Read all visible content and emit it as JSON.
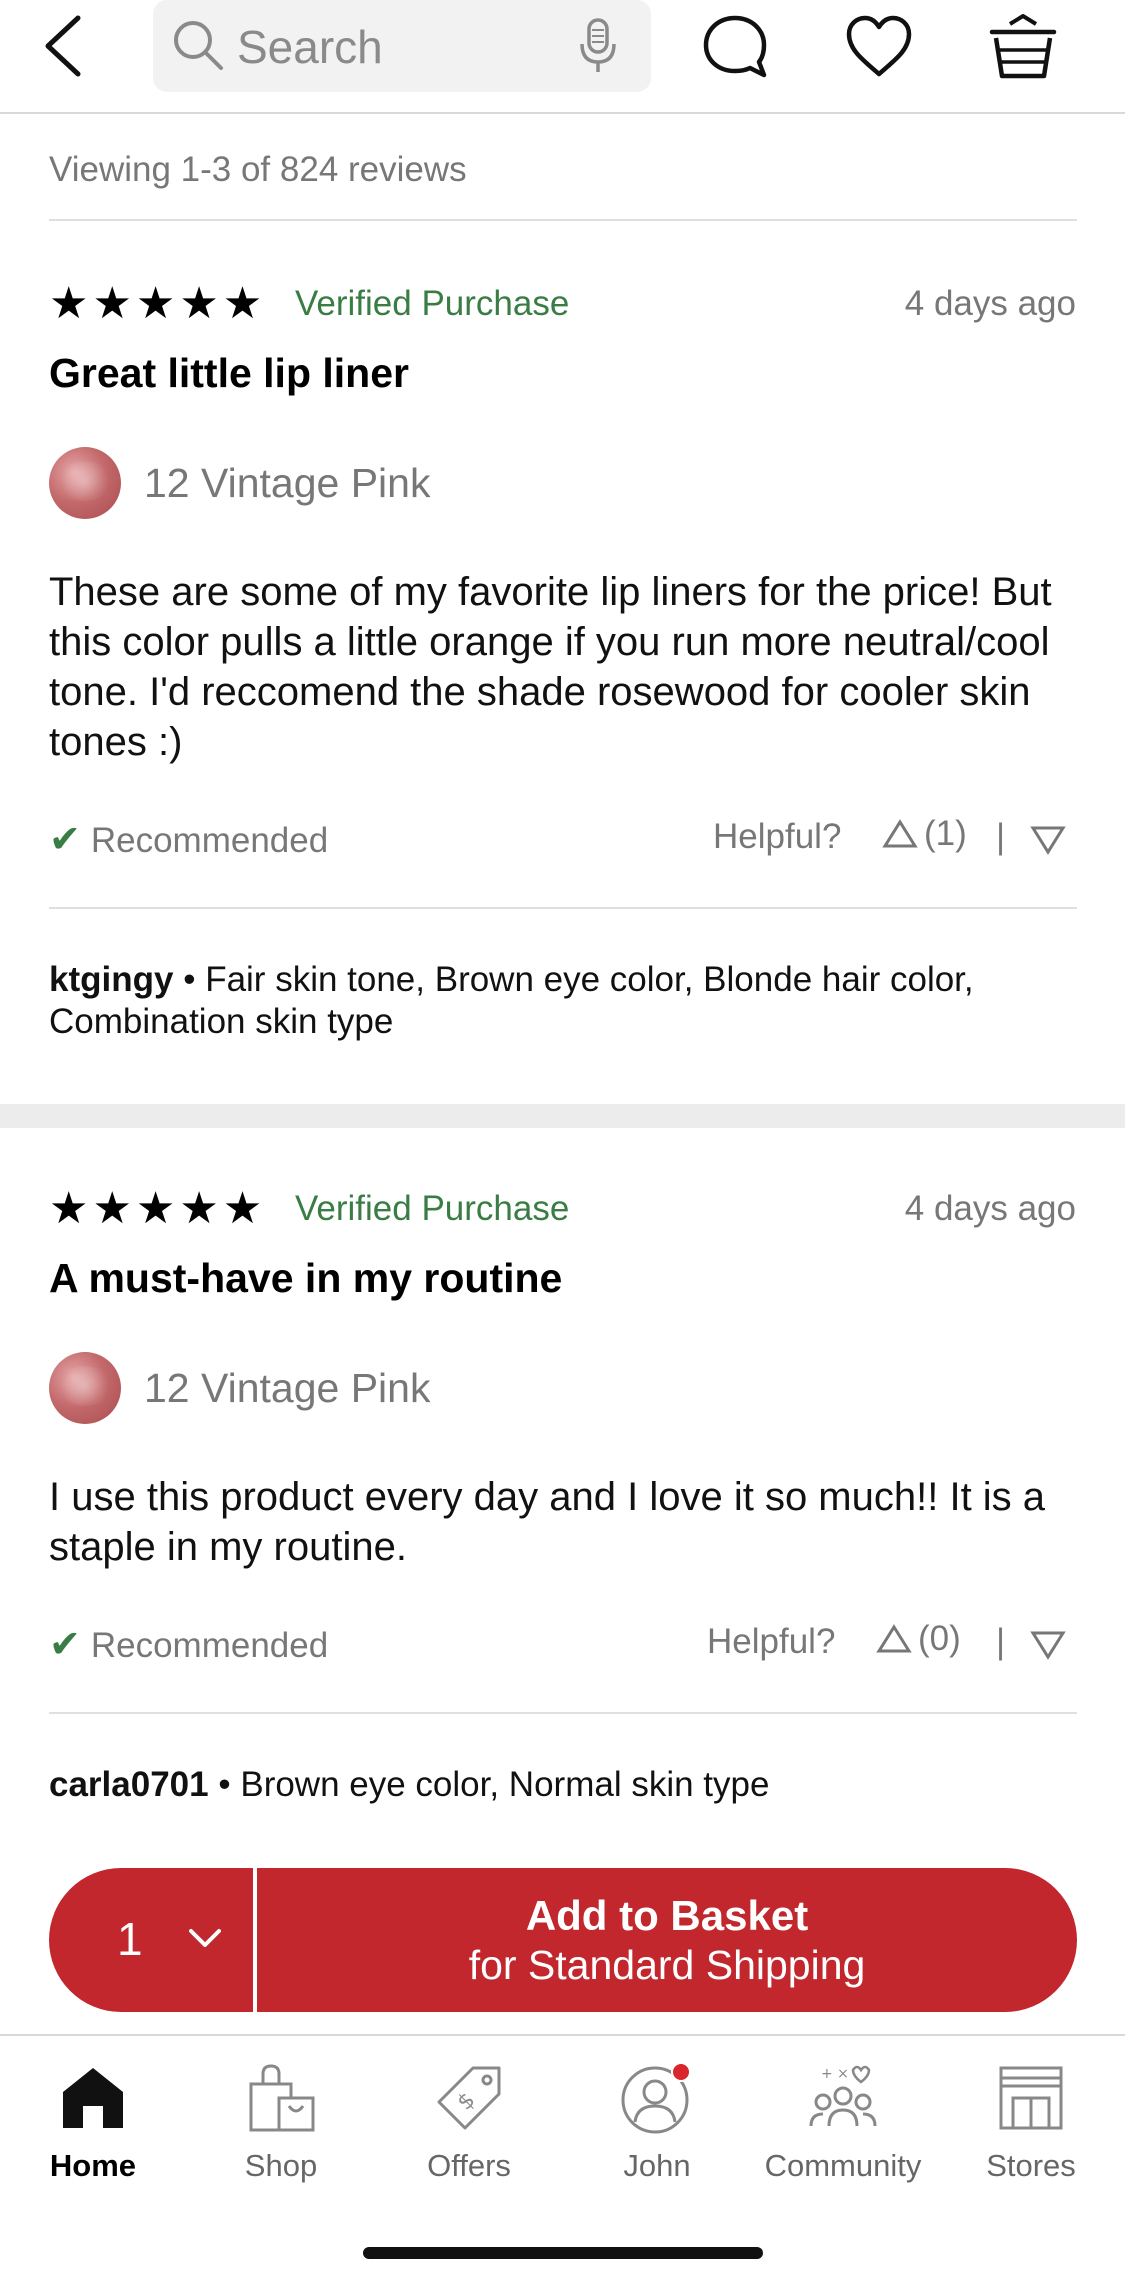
{
  "header": {
    "search_placeholder": "Search",
    "icons": [
      "back-chevron-icon",
      "search-icon",
      "microphone-icon",
      "chat-icon",
      "heart-icon",
      "basket-icon"
    ]
  },
  "reviews_meta": "Viewing 1-3 of 824 reviews",
  "reviews": [
    {
      "stars": "★★★★★",
      "rating": 5,
      "verified": "Verified Purchase",
      "date": "4 days ago",
      "title": "Great little lip liner",
      "shade": "12 Vintage Pink",
      "text": "These are some of my favorite lip liners for the price! But this color pulls a little orange if you run more neutral/cool tone. I'd reccomend the shade rosewood for cooler skin tones :)",
      "recommended": "Recommended",
      "helpful_label": "Helpful?",
      "helpful_up": "(1)",
      "separator": "|",
      "username": "ktgingy",
      "bullet": "•",
      "traits": "Fair skin tone, Brown eye color, Blonde hair color, Combination skin type"
    },
    {
      "stars": "★★★★★",
      "rating": 5,
      "verified": "Verified Purchase",
      "date": "4 days ago",
      "title": "A must-have in my routine",
      "shade": "12 Vintage Pink",
      "text": "I use this product every day and I love it so much!! It is a staple in my routine.",
      "recommended": "Recommended",
      "helpful_label": "Helpful?",
      "helpful_up": "(0)",
      "separator": "|",
      "username": "carla0701",
      "bullet": "•",
      "traits": "Brown eye color, Normal skin type"
    }
  ],
  "cta": {
    "quantity": "1",
    "line1": "Add to Basket",
    "line2": "for Standard Shipping",
    "color": "#c1272d"
  },
  "tabs": [
    {
      "label": "Home",
      "icon": "home-icon",
      "active": true
    },
    {
      "label": "Shop",
      "icon": "shopping-bag-icon",
      "active": false
    },
    {
      "label": "Offers",
      "icon": "price-tag-icon",
      "active": false
    },
    {
      "label": "John",
      "icon": "profile-icon",
      "active": false
    },
    {
      "label": "Community",
      "icon": "community-icon",
      "active": false
    },
    {
      "label": "Stores",
      "icon": "store-icon",
      "active": false
    }
  ],
  "colors": {
    "verified_green": "#3a7d44",
    "notification_dot": "#d9262c",
    "accent_red": "#c1272d"
  }
}
